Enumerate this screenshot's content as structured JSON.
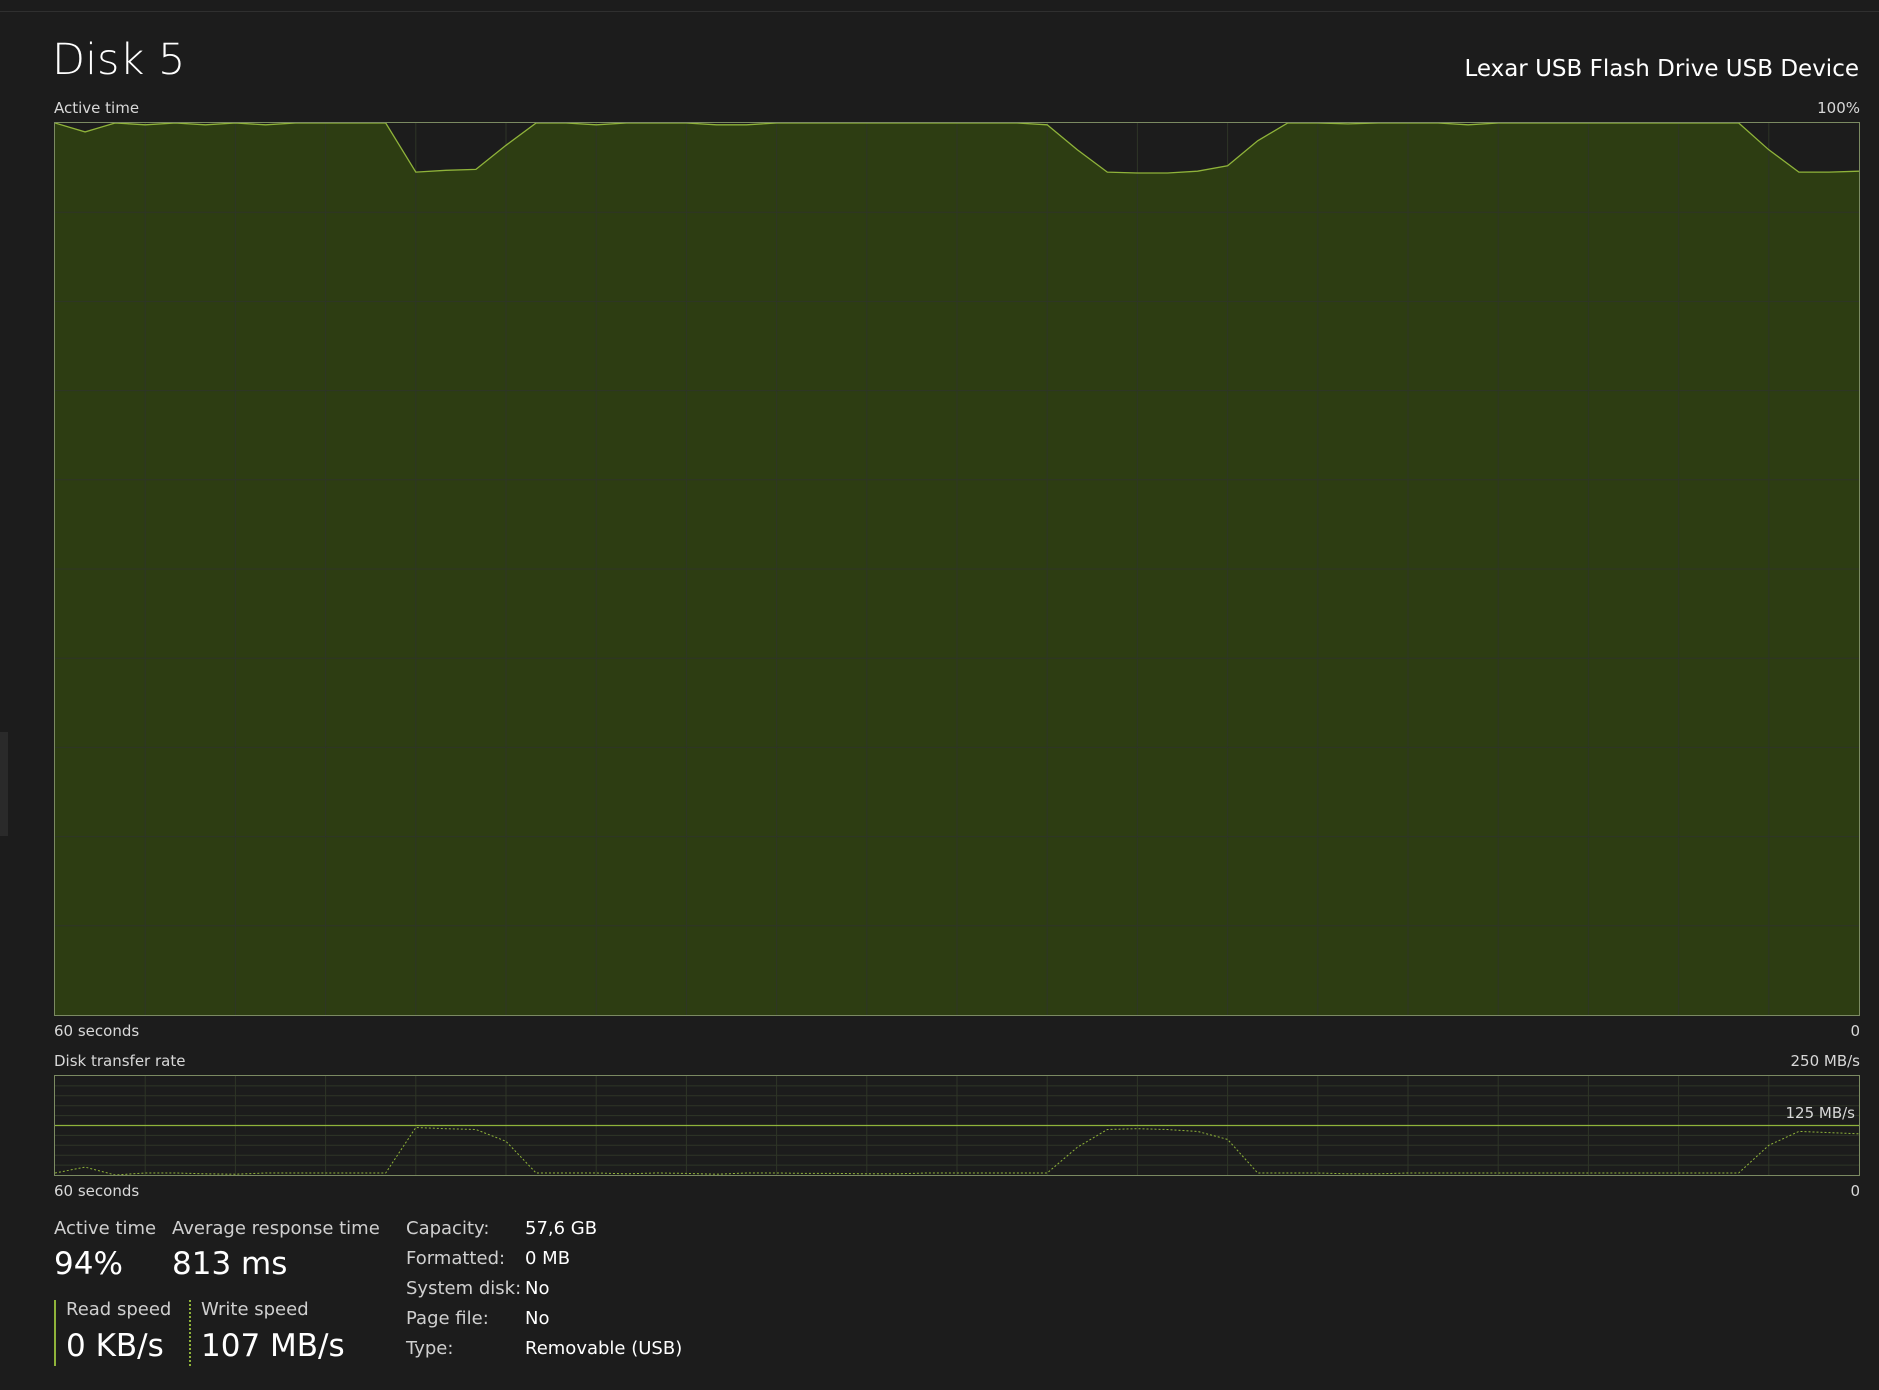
{
  "header": {
    "title": "Disk 5",
    "device_name": "Lexar USB Flash Drive USB Device"
  },
  "active_chart": {
    "label": "Active time",
    "max_label": "100%",
    "time_left_label": "60 seconds",
    "time_right_label": "0"
  },
  "transfer_chart": {
    "label": "Disk transfer rate",
    "max_label": "250 MB/s",
    "mid_label": "125 MB/s",
    "time_left_label": "60 seconds",
    "time_right_label": "0"
  },
  "stats": {
    "active_time_label": "Active time",
    "active_time_value": "94%",
    "avg_response_label": "Average response time",
    "avg_response_value": "813 ms",
    "read_speed_label": "Read speed",
    "read_speed_value": "0 KB/s",
    "write_speed_label": "Write speed",
    "write_speed_value": "107 MB/s"
  },
  "info": [
    {
      "key": "Capacity:",
      "value": "57,6 GB"
    },
    {
      "key": "Formatted:",
      "value": "0 MB"
    },
    {
      "key": "System disk:",
      "value": "No"
    },
    {
      "key": "Page file:",
      "value": "No"
    },
    {
      "key": "Type:",
      "value": "Removable (USB)"
    }
  ],
  "colors": {
    "accent": "#8fb33a",
    "fill": "#2d3d12",
    "background": "#1c1c1c"
  },
  "chart_data": [
    {
      "type": "area",
      "title": "Active time",
      "ylabel": "",
      "xlabel": "",
      "ylim": [
        0,
        100
      ],
      "x_range_seconds": [
        60,
        0
      ],
      "grid": true,
      "series": [
        {
          "values": [
            100,
            99,
            100,
            99.8,
            100,
            99.8,
            100,
            99.8,
            100,
            100,
            100,
            100,
            94.5,
            94.7,
            94.8,
            97.5,
            100,
            100,
            99.8,
            100,
            100,
            100,
            99.8,
            99.8,
            100,
            100,
            100,
            100,
            100,
            100,
            100,
            100,
            100,
            99.8,
            97,
            94.5,
            94.4,
            94.4,
            94.6,
            95.2,
            98,
            100,
            100,
            99.9,
            100,
            100,
            100,
            99.8,
            100,
            100,
            100,
            100,
            100,
            100,
            100,
            100,
            100,
            97,
            94.5,
            94.5,
            94.6
          ]
        }
      ]
    },
    {
      "type": "line",
      "title": "Disk transfer rate",
      "ylabel": "",
      "xlabel": "",
      "ylim": [
        0,
        250
      ],
      "x_range_seconds": [
        60,
        0
      ],
      "grid": true,
      "series": [
        {
          "values": [
            5,
            20,
            0,
            5,
            5,
            3,
            2,
            5,
            5,
            5,
            5,
            5,
            120,
            117,
            115,
            85,
            5,
            5,
            5,
            3,
            5,
            4,
            2,
            5,
            5,
            4,
            4,
            3,
            3,
            5,
            5,
            5,
            5,
            5,
            70,
            115,
            117,
            115,
            110,
            90,
            5,
            5,
            5,
            3,
            3,
            5,
            5,
            5,
            5,
            5,
            5,
            5,
            5,
            5,
            5,
            5,
            5,
            75,
            110,
            107,
            104
          ]
        },
        {
          "values": [
            125,
            125,
            125,
            125,
            125,
            125,
            125,
            125,
            125,
            125,
            125,
            125,
            125,
            125,
            125,
            125,
            125,
            125,
            125,
            125,
            125,
            125,
            125,
            125,
            125,
            125,
            125,
            125,
            125,
            125,
            125,
            125,
            125,
            125,
            125,
            125,
            125,
            125,
            125,
            125,
            125,
            125,
            125,
            125,
            125,
            125,
            125,
            125,
            125,
            125,
            125,
            125,
            125,
            125,
            125,
            125,
            125,
            125,
            125,
            125,
            125
          ]
        }
      ]
    }
  ]
}
